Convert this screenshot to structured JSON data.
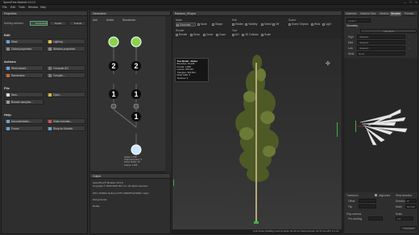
{
  "window": {
    "title": "SpeedTree Modeler 10.0.0"
  },
  "menu": [
    "File",
    "Edit",
    "Tools",
    "Window",
    "Help"
  ],
  "properties": {
    "title": "Properties",
    "selection": "Nothing selected",
    "sel_tabs": [
      "Generators",
      "Nodes",
      "Fronds"
    ],
    "edit": {
      "heading": "Edit",
      "buttons": [
        "Wind",
        "Lighting",
        "Global properties",
        "Window properties"
      ]
    },
    "actions": {
      "heading": "Actions",
      "buttons": [
        "Wind wizard...",
        "Compute AO",
        "Randomize",
        "Compile..."
      ]
    },
    "file": {
      "heading": "File",
      "buttons": [
        "New...",
        "Open...",
        "Browse samples..."
      ]
    },
    "help": {
      "heading": "Help",
      "buttons": [
        "Documentation...",
        "Video tutorials...",
        "Forum",
        "Shop for Models"
      ]
    }
  },
  "generation": {
    "title": "Generation",
    "toolbar": [
      "Add",
      "Delete",
      "Randomize"
    ],
    "badges": [
      "2",
      "2",
      "1",
      "1",
      "1"
    ],
    "info": [
      "Nodes: 1,708",
      "Total Generators: 5",
      "Active Nodes: 15",
      "Leaves: 1,040"
    ]
  },
  "output": {
    "title": "Output",
    "lines": [
      "SpeedTree® Modeler 10.0.0",
      "Copyright © 2009-2024 IDV, Inc. All rights reserved.",
      "",
      "GPU: NVIDIA GeForce RTX 4090/PCIe/SSE2, Open",
      "",
      "Using license",
      "",
      "Ready."
    ]
  },
  "viewport": {
    "tab": "Random_09.spm",
    "modes": {
      "label": "Mode",
      "items": [
        "Generate",
        "Node",
        "Shape"
      ]
    },
    "edit": {
      "label": "Edit",
      "items": [
        "Hidden",
        "Visibility",
        "Select",
        "Off"
      ]
    },
    "scene": {
      "label": "Scene",
      "items": [
        "Scene Objects",
        "Wind",
        "Light"
      ]
    },
    "render": {
      "label": "Render",
      "items": [
        "Render",
        "Show",
        "Clone",
        "Zoom"
      ]
    },
    "tools": {
      "label": "Tool",
      "items": [
        "AO",
        "3D Collision",
        "Scale"
      ]
    },
    "stats_title": "Tree Model - Nodes",
    "stats": [
      {
        "k": "Branches:",
        "v": "18,246"
      },
      {
        "k": "Fronds:",
        "v": "1,608"
      },
      {
        "k": "Leaves:",
        "v": "105,110"
      },
      {
        "k": "Triangles:",
        "v": "218,504"
      },
      {
        "k": "Draw Calls:",
        "v": "5"
      },
      {
        "k": "Textures:",
        "v": "3"
      }
    ],
    "status": "LOD: Draw (Visibility)   Leaf Compute: 81.29 ms   Total Compute: 91.79 ms   GPU: 3.1 ms"
  },
  "right": {
    "tabs": [
      "Materials",
      "Material Sets",
      "Meshes",
      "Weather",
      "Presets"
    ],
    "active_tab": "Weather",
    "lod": "Level 2",
    "geometry_label": "Geometry",
    "add_mesh": "Add Mesh",
    "rows": [
      {
        "k": "High",
        "v": "<Default>"
      },
      {
        "k": "Med",
        "v": "<Default>"
      },
      {
        "k": "Low",
        "v": "<Default>"
      },
      {
        "k": "Wind",
        "v": "None"
      }
    ],
    "transform": {
      "label": "Transform",
      "alignment": "Alignment",
      "offset": "Offset",
      "flip": "Flip"
    },
    "wind": {
      "label": "Wind direction",
      "dir": "Direction",
      "dir_val": "0°",
      "mode": "Mode",
      "mode_val": "Normal"
    },
    "play": {
      "label": "Play controls",
      "playback": "Pre-seeding"
    },
    "scale": {
      "label": "Scale",
      "val": "1.0"
    },
    "compute": "Compute"
  },
  "colors": {
    "accent": "#3bb34a",
    "generator_green": "#8ed14b",
    "node_blue": "#cfe6ff"
  }
}
